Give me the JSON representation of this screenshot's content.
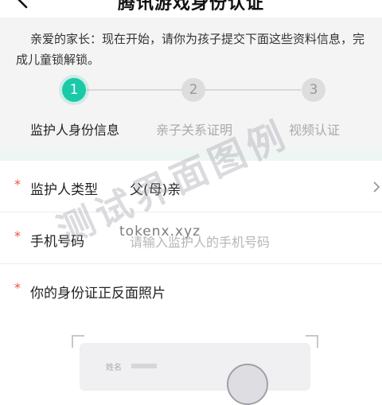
{
  "header": {
    "title": "腾讯游戏身份认证",
    "back_icon": "back-arrow-icon"
  },
  "notice": {
    "text": "亲爱的家长：现在开始，请你为孩子提交下面这些资料信息，完成儿童锁解锁。"
  },
  "steps": [
    {
      "number": "1",
      "label": "监护人身份信息",
      "active": true
    },
    {
      "number": "2",
      "label": "亲子关系证明",
      "active": false
    },
    {
      "number": "3",
      "label": "视频认证",
      "active": false
    }
  ],
  "form": {
    "guardian_type": {
      "required_mark": "*",
      "label": "监护人类型",
      "value": "父(母)亲"
    },
    "phone": {
      "required_mark": "*",
      "label": "手机号码",
      "placeholder": "请输入监护人的手机号码"
    },
    "id_photo": {
      "required_mark": "*",
      "label": "你的身份证正反面照片",
      "card_name_label": "姓名"
    }
  },
  "watermark": {
    "url": "tokenx.xyz",
    "text": "测试界面图例"
  },
  "colors": {
    "accent": "#19c9a8",
    "required": "#e8543c",
    "background": "#f4f4f5"
  }
}
